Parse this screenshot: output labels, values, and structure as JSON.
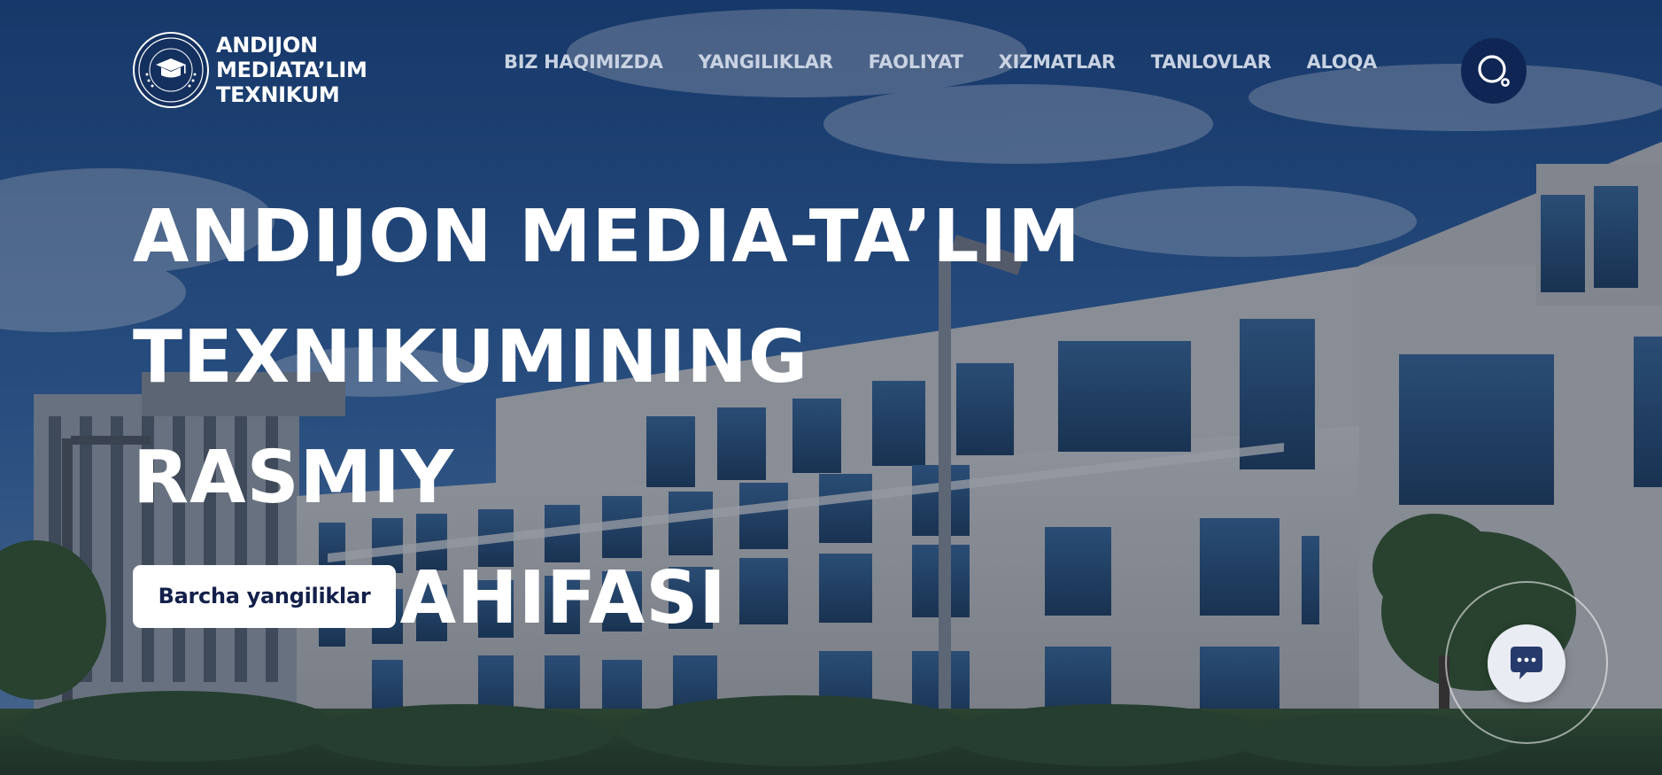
{
  "site": {
    "logo": {
      "emblem_icon": "graduation-cap-seal-icon",
      "emblem_ring_top": "ANDIJON MEDIATA'LIM",
      "emblem_ring_bottom": "TEXNIKUMI",
      "line1": "ANDIJON",
      "line2": "MEDIATA’LIM",
      "line3": "TEXNIKUM"
    },
    "nav": [
      {
        "label": "BIZ HAQIMIZDA"
      },
      {
        "label": "YANGILIKLAR"
      },
      {
        "label": "FAOLIYAT"
      },
      {
        "label": "XIZMATLAR"
      },
      {
        "label": "TANLOVLAR"
      },
      {
        "label": "ALOQA"
      }
    ],
    "search": {
      "icon": "search-icon"
    }
  },
  "hero": {
    "title_lines": [
      "ANDIJON MEDIA-TA’LIM",
      "TEXNIKUMINING RASMIY",
      "WEB SAHIFASI"
    ],
    "cta_label": "Barcha yangiliklar"
  },
  "chat": {
    "icon": "chat-bubble-icon"
  },
  "colors": {
    "navy": "#0f2554",
    "nav_text": "#c9d2e2",
    "cta_text": "#13204a",
    "white": "#ffffff",
    "sky": "#2f5f9c"
  }
}
